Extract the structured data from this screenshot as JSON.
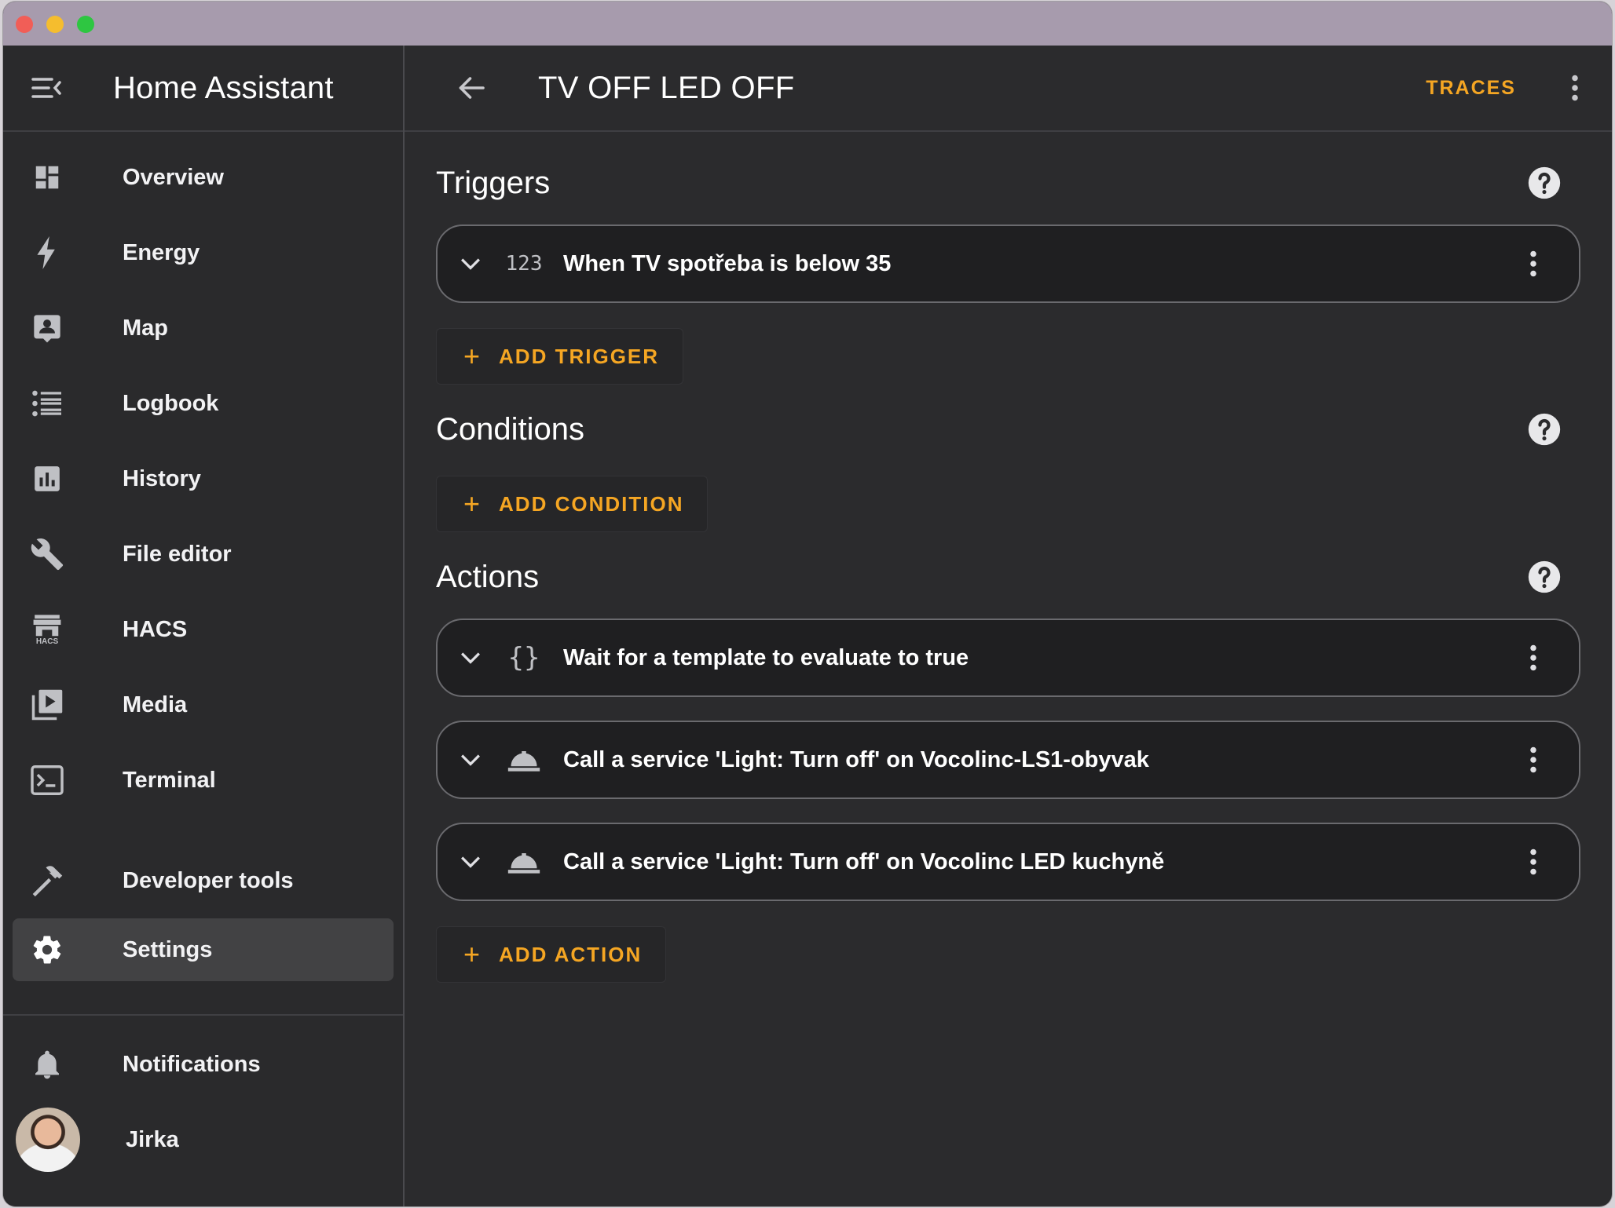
{
  "app_title": "Home Assistant",
  "nav": [
    {
      "label": "Overview",
      "icon": "dashboard-icon"
    },
    {
      "label": "Energy",
      "icon": "lightning-icon"
    },
    {
      "label": "Map",
      "icon": "map-icon"
    },
    {
      "label": "Logbook",
      "icon": "list-icon"
    },
    {
      "label": "History",
      "icon": "bar-chart-icon"
    },
    {
      "label": "File editor",
      "icon": "wrench-icon"
    },
    {
      "label": "HACS",
      "icon": "hacs-store-icon"
    },
    {
      "label": "Media",
      "icon": "media-play-icon"
    },
    {
      "label": "Terminal",
      "icon": "terminal-icon"
    },
    {
      "label": "Developer tools",
      "icon": "hammer-icon"
    },
    {
      "label": "Settings",
      "icon": "gear-icon",
      "selected": true
    }
  ],
  "nav_bottom": {
    "notifications": "Notifications",
    "user": "Jirka"
  },
  "hacs_badge": "HACS",
  "header": {
    "title": "TV OFF LED OFF",
    "traces_label": "TRACES"
  },
  "sections": {
    "triggers": {
      "title": "Triggers",
      "items": [
        {
          "icon_text": "123",
          "text": "When TV spotřeba is below 35"
        }
      ],
      "add_label": "ADD TRIGGER"
    },
    "conditions": {
      "title": "Conditions",
      "add_label": "ADD CONDITION"
    },
    "actions": {
      "title": "Actions",
      "items": [
        {
          "icon_text": "{}",
          "text": "Wait for a template to evaluate to true"
        },
        {
          "icon": "service-bell-icon",
          "text": "Call a service 'Light: Turn off' on Vocolinc-LS1-obyvak"
        },
        {
          "icon": "service-bell-icon",
          "text": "Call a service 'Light: Turn off' on Vocolinc LED kuchyně"
        }
      ],
      "add_label": "ADD ACTION"
    }
  },
  "colors": {
    "accent": "#f5a623",
    "background": "#2b2b2d",
    "card": "#1f1f21"
  }
}
